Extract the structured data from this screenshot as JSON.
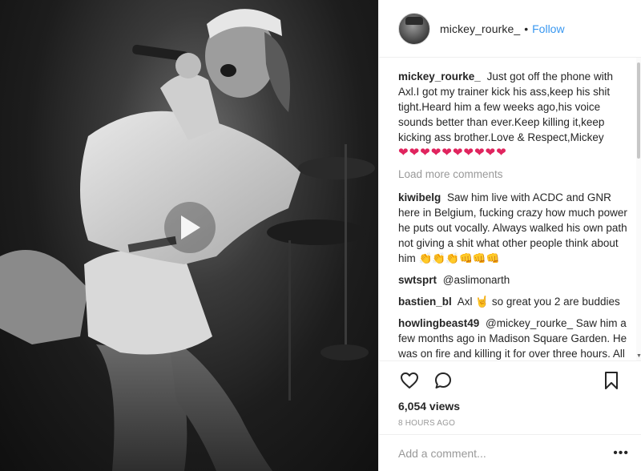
{
  "post": {
    "username": "mickey_rourke_",
    "separator": "•",
    "follow_label": "Follow",
    "avatar_alt": "profile-avatar"
  },
  "comments": [
    {
      "user": "mickey_rourke_",
      "text": "Just got off the phone with Axl.I got my trainer kick his ass,keep his shit tight.Heard him a few weeks ago,his voice sounds better than ever.Keep killing it,keep kicking ass brother.Love & Respect,Mickey",
      "hearts": "❤❤❤❤❤❤❤❤❤❤"
    }
  ],
  "load_more_label": "Load more comments",
  "more_comments": [
    {
      "user": "kiwibelg",
      "text": "Saw him live with ACDC and GNR here in Belgium, fucking crazy how much power he puts out vocally. Always walked his own path not giving a shit what other people think about him",
      "emoji": "👏👏👏👊👊👊"
    },
    {
      "user": "swtsprt",
      "text": "@aslimonarth"
    },
    {
      "user": "bastien_bl",
      "text": "Axl 🤘 so great you 2 are buddies"
    },
    {
      "user": "howlingbeast49",
      "text": "@mickey_rourke_ Saw him a few months ago in Madison Square Garden. He was on fire and killing it for over three hours. All over the stage. The"
    }
  ],
  "stats": {
    "views": "6,054 views",
    "time": "8 HOURS AGO"
  },
  "composer": {
    "placeholder": "Add a comment...",
    "more_label": "•••"
  },
  "icons": {
    "like": "heart-outline-icon",
    "comment": "speech-bubble-icon",
    "save": "bookmark-icon",
    "play": "play-icon"
  },
  "colors": {
    "follow": "#3897f0",
    "heart": "#e0245e",
    "muted": "#999999"
  }
}
